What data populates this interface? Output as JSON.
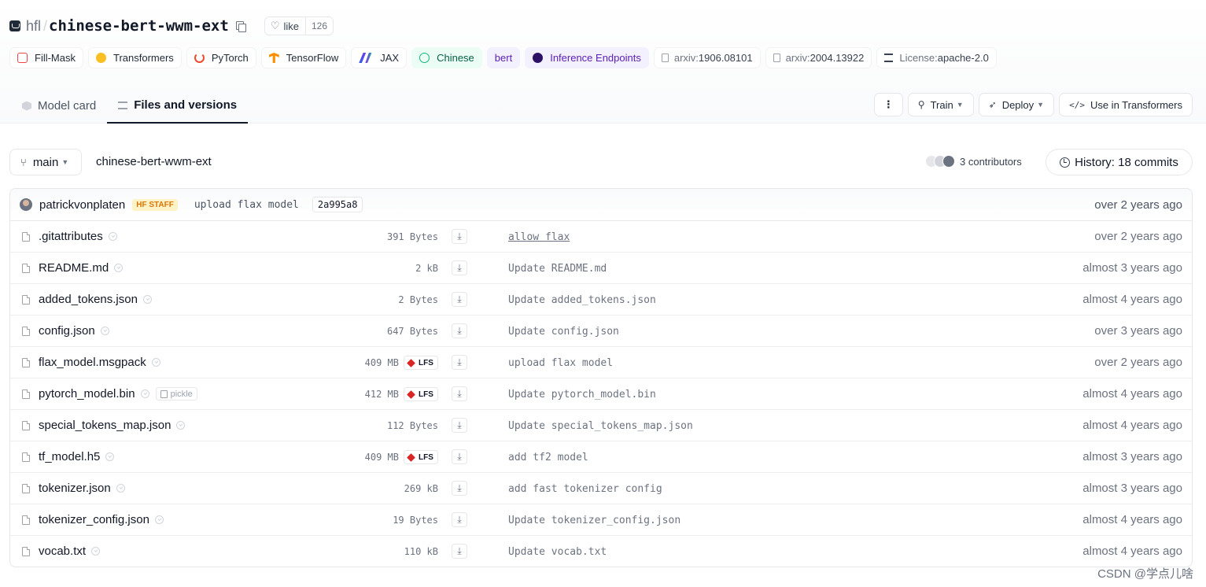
{
  "repo": {
    "owner": "hfl",
    "name": "chinese-bert-wwm-ext",
    "like_label": "like",
    "like_count": "126"
  },
  "tags": [
    {
      "label": "Fill-Mask",
      "icon": "fill-mask-icon",
      "color": "#ef4444"
    },
    {
      "label": "Transformers",
      "icon": "hugging-face-icon",
      "color": "#f59e0b"
    },
    {
      "label": "PyTorch",
      "icon": "pytorch-icon",
      "color": "#ee4c2c"
    },
    {
      "label": "TensorFlow",
      "icon": "tensorflow-icon",
      "color": "#ff8f00"
    },
    {
      "label": "JAX",
      "icon": "jax-icon",
      "color": "#6366f1"
    },
    {
      "label": "Chinese",
      "icon": "globe-icon",
      "color": "#10b981"
    },
    {
      "label": "bert",
      "icon": "",
      "color": "#7c3aed"
    },
    {
      "label": "Inference Endpoints",
      "icon": "inference-icon",
      "color": "#6d28d9"
    },
    {
      "prefix": "arxiv:",
      "value": "1906.08101",
      "icon": "paper-icon"
    },
    {
      "prefix": "arxiv:",
      "value": "2004.13922",
      "icon": "paper-icon"
    },
    {
      "prefix": "License: ",
      "value": "apache-2.0",
      "icon": "bank-icon"
    }
  ],
  "tabs": [
    {
      "label": "Model card",
      "active": false
    },
    {
      "label": "Files and versions",
      "active": true
    }
  ],
  "actions": {
    "more": "⋮",
    "train": "Train",
    "deploy": "Deploy",
    "use": "Use in Transformers"
  },
  "branch": {
    "name": "main",
    "path": "chinese-bert-wwm-ext",
    "contributors": "3 contributors",
    "history": "History: 18 commits"
  },
  "last_commit": {
    "author": "patrickvonplaten",
    "badge": "HF STAFF",
    "message": "upload flax model",
    "hash": "2a995a8",
    "date": "over 2 years ago"
  },
  "files": [
    {
      "name": ".gitattributes",
      "size": "391 Bytes",
      "lfs": false,
      "pickle": false,
      "message": "allow flax",
      "link": true,
      "date": "over 2 years ago"
    },
    {
      "name": "README.md",
      "size": "2 kB",
      "lfs": false,
      "pickle": false,
      "message": "Update README.md",
      "link": false,
      "date": "almost 3 years ago"
    },
    {
      "name": "added_tokens.json",
      "size": "2 Bytes",
      "lfs": false,
      "pickle": false,
      "message": "Update added_tokens.json",
      "link": false,
      "date": "almost 4 years ago"
    },
    {
      "name": "config.json",
      "size": "647 Bytes",
      "lfs": false,
      "pickle": false,
      "message": "Update config.json",
      "link": false,
      "date": "over 3 years ago"
    },
    {
      "name": "flax_model.msgpack",
      "size": "409 MB",
      "lfs": true,
      "pickle": false,
      "message": "upload flax model",
      "link": false,
      "date": "over 2 years ago"
    },
    {
      "name": "pytorch_model.bin",
      "size": "412 MB",
      "lfs": true,
      "pickle": true,
      "message": "Update pytorch_model.bin",
      "link": false,
      "date": "almost 4 years ago"
    },
    {
      "name": "special_tokens_map.json",
      "size": "112 Bytes",
      "lfs": false,
      "pickle": false,
      "message": "Update special_tokens_map.json",
      "link": false,
      "date": "almost 4 years ago"
    },
    {
      "name": "tf_model.h5",
      "size": "409 MB",
      "lfs": true,
      "pickle": false,
      "message": "add tf2 model",
      "link": false,
      "date": "almost 3 years ago"
    },
    {
      "name": "tokenizer.json",
      "size": "269 kB",
      "lfs": false,
      "pickle": false,
      "message": "add fast tokenizer config",
      "link": false,
      "date": "almost 3 years ago"
    },
    {
      "name": "tokenizer_config.json",
      "size": "19 Bytes",
      "lfs": false,
      "pickle": false,
      "message": "Update tokenizer_config.json",
      "link": false,
      "date": "almost 4 years ago"
    },
    {
      "name": "vocab.txt",
      "size": "110 kB",
      "lfs": false,
      "pickle": false,
      "message": "Update vocab.txt",
      "link": false,
      "date": "almost 4 years ago"
    }
  ],
  "labels": {
    "lfs": "LFS",
    "pickle": "pickle"
  },
  "watermark": "CSDN @学点儿啥"
}
